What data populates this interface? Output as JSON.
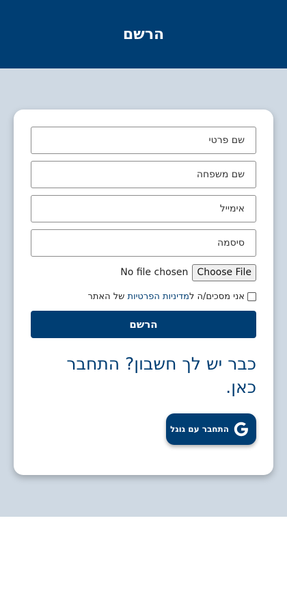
{
  "header": {
    "title": "הרשם"
  },
  "form": {
    "first_name_placeholder": "שם פרטי",
    "last_name_placeholder": "שם משפחה",
    "email_placeholder": "אימייל",
    "password_placeholder": "סיסמה",
    "file_button_label": "Choose File",
    "file_status": "No file chosen",
    "consent_text_before": "אני מסכים/ה ל",
    "consent_link": "מדיניות הפרטיות",
    "consent_text_after": " של האתר",
    "consent_checked": false,
    "submit_label": "הרשם"
  },
  "login_prompt": "כבר יש לך חשבון? התחבר כאן.",
  "google_button": {
    "label": "התחבר עם גוגל",
    "icon": "google-g-icon"
  },
  "colors": {
    "primary": "#003e73",
    "band": "#cfd9e3",
    "card": "#ffffff"
  }
}
